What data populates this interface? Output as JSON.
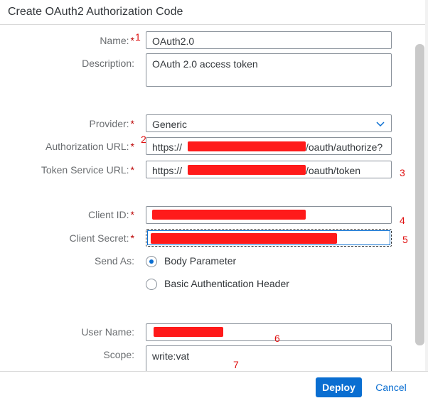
{
  "dialog": {
    "title": "Create OAuth2 Authorization Code"
  },
  "form": {
    "name": {
      "label": "Name:",
      "value": "OAuth2.0"
    },
    "description": {
      "label": "Description:",
      "value": "OAuth 2.0 access token"
    },
    "provider": {
      "label": "Provider:",
      "value": "Generic"
    },
    "authorization_url": {
      "label": "Authorization URL:",
      "value_prefix": "https://",
      "value_suffix": "/oauth/authorize?"
    },
    "token_service_url": {
      "label": "Token Service URL:",
      "value_prefix": "https://",
      "value_suffix": "/oauth/token"
    },
    "client_id": {
      "label": "Client ID:"
    },
    "client_secret": {
      "label": "Client Secret:"
    },
    "send_as": {
      "label": "Send As:",
      "options": [
        "Body Parameter",
        "Basic Authentication Header"
      ],
      "selected": "Body Parameter"
    },
    "user_name": {
      "label": "User Name:"
    },
    "scope": {
      "label": "Scope:",
      "value": "write:vat"
    },
    "required_marker": "*"
  },
  "annotations": [
    "1",
    "2",
    "3",
    "4",
    "5",
    "6",
    "7"
  ],
  "footer": {
    "deploy_label": "Deploy",
    "cancel_label": "Cancel"
  },
  "colors": {
    "accent": "#0a6ed1",
    "required": "#bb0000",
    "redaction": "#ff1a1a",
    "annotation": "#e01010"
  }
}
